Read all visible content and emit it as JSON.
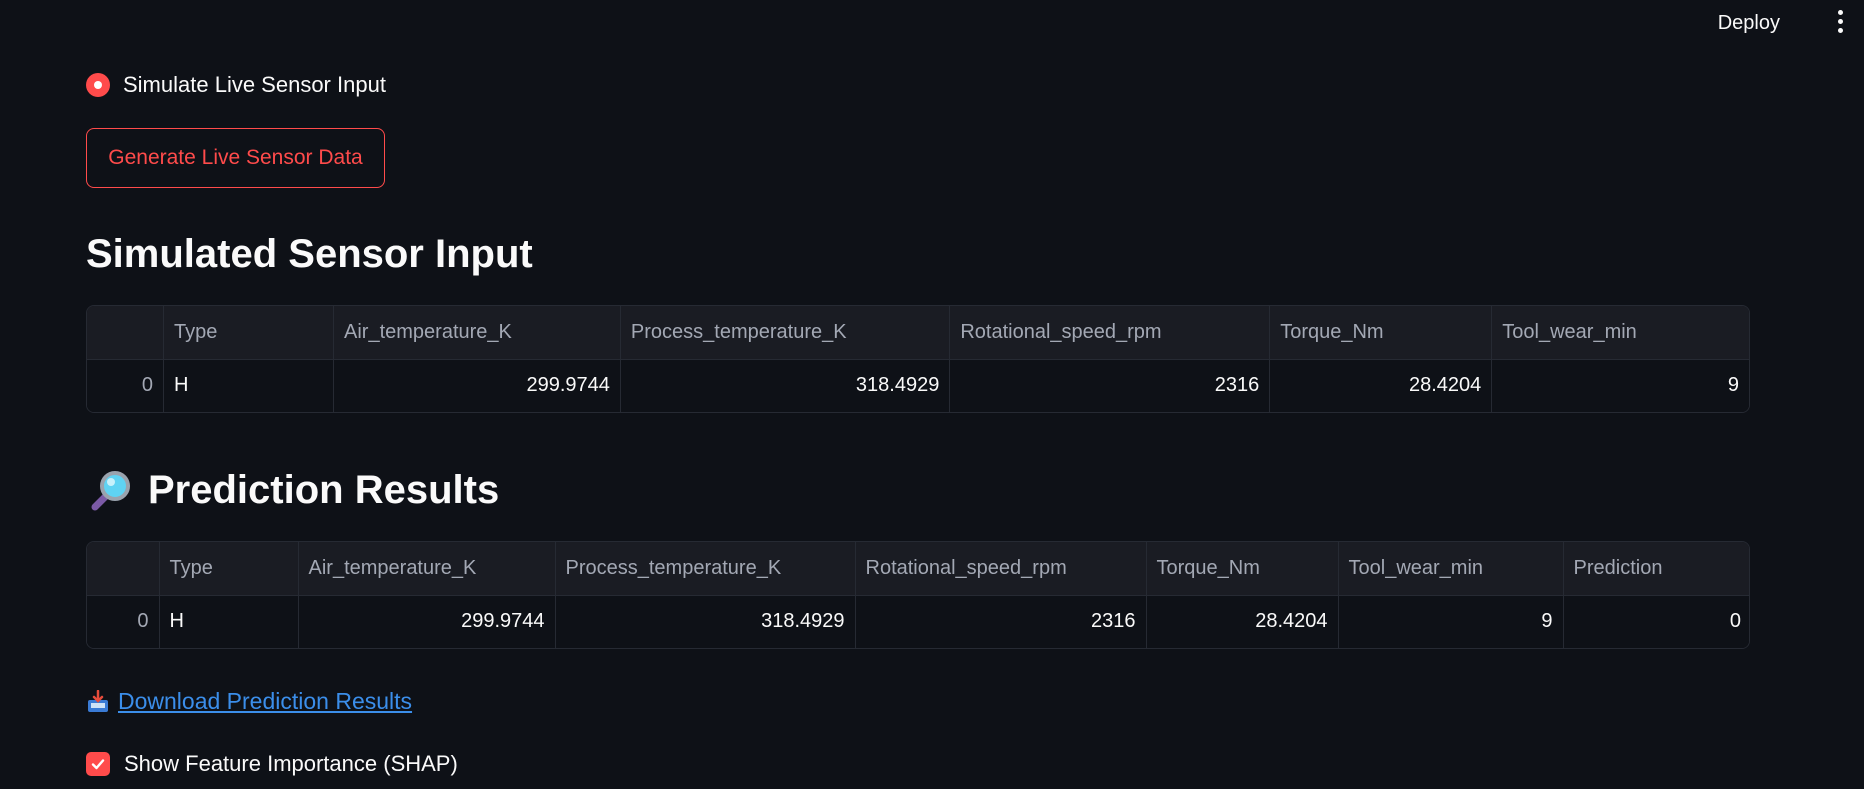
{
  "header": {
    "deploy_label": "Deploy",
    "menu_icon": "kebab-menu-icon"
  },
  "radio": {
    "label": "Simulate Live Sensor Input",
    "selected": true
  },
  "generate_button": {
    "label": "Generate Live Sensor Data"
  },
  "sim_section": {
    "title": "Simulated Sensor Input",
    "columns": [
      "",
      "Type",
      "Air_temperature_K",
      "Process_temperature_K",
      "Rotational_speed_rpm",
      "Torque_Nm",
      "Tool_wear_min"
    ],
    "rows": [
      [
        "0",
        "H",
        "299.9744",
        "318.4929",
        "2316",
        "28.4204",
        "9"
      ]
    ]
  },
  "pred_section": {
    "title": "Prediction Results",
    "icon": "magnifying-glass-icon",
    "columns": [
      "",
      "Type",
      "Air_temperature_K",
      "Process_temperature_K",
      "Rotational_speed_rpm",
      "Torque_Nm",
      "Tool_wear_min",
      "Prediction"
    ],
    "rows": [
      [
        "0",
        "H",
        "299.9744",
        "318.4929",
        "2316",
        "28.4204",
        "9",
        "0"
      ]
    ]
  },
  "download": {
    "label": "Download Prediction Results",
    "icon": "inbox-tray-icon"
  },
  "shap_checkbox": {
    "label": "Show Feature Importance (SHAP)",
    "checked": true
  },
  "colors": {
    "background": "#0e1117",
    "accent": "#ff4b4b",
    "link": "#3b8eea",
    "header_bg": "#1a1c23"
  }
}
